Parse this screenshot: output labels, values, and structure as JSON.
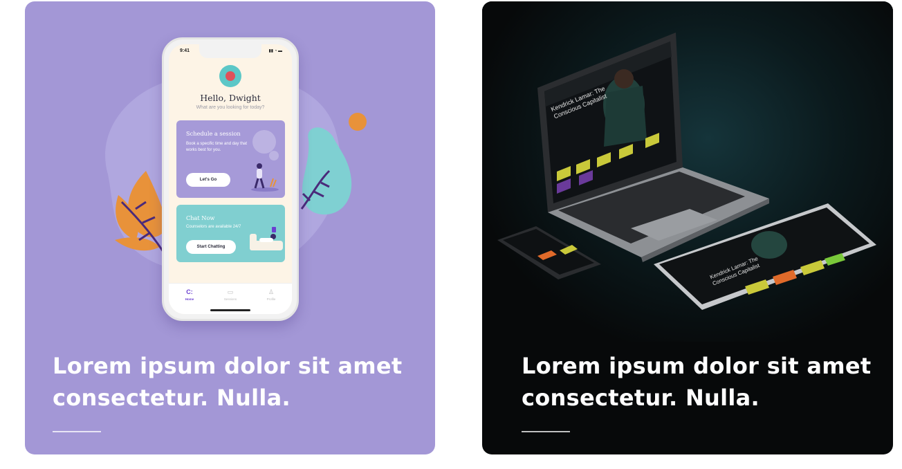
{
  "cards": [
    {
      "title": "Lorem ipsum dolor sit amet consectetur. Nulla.",
      "image": {
        "app": {
          "status_time": "9:41",
          "greeting": "Hello, Dwight",
          "prompt": "What are you looking for today?",
          "tiles": [
            {
              "title": "Schedule a session",
              "description": "Book a specific time and day that works best for you.",
              "button": "Let's Go"
            },
            {
              "title": "Chat Now",
              "description": "Counselors are available 24/7",
              "button": "Start Chatting"
            }
          ],
          "tabs": [
            {
              "label": "Home",
              "icon": "home-icon"
            },
            {
              "label": "Sessions",
              "icon": "chat-icon"
            },
            {
              "label": "Profile",
              "icon": "profile-icon"
            }
          ]
        },
        "colors": {
          "background": "#a397d6",
          "accent_orange": "#e8923a",
          "accent_teal": "#7fd0d2"
        }
      }
    },
    {
      "title": "Lorem ipsum dolor sit amet consectetur. Nulla.",
      "image": {
        "headline": "Kendrick Lamar: The Conscious Capitalist",
        "colors": {
          "background": "#07090a",
          "glow": "#15343a"
        }
      }
    }
  ]
}
